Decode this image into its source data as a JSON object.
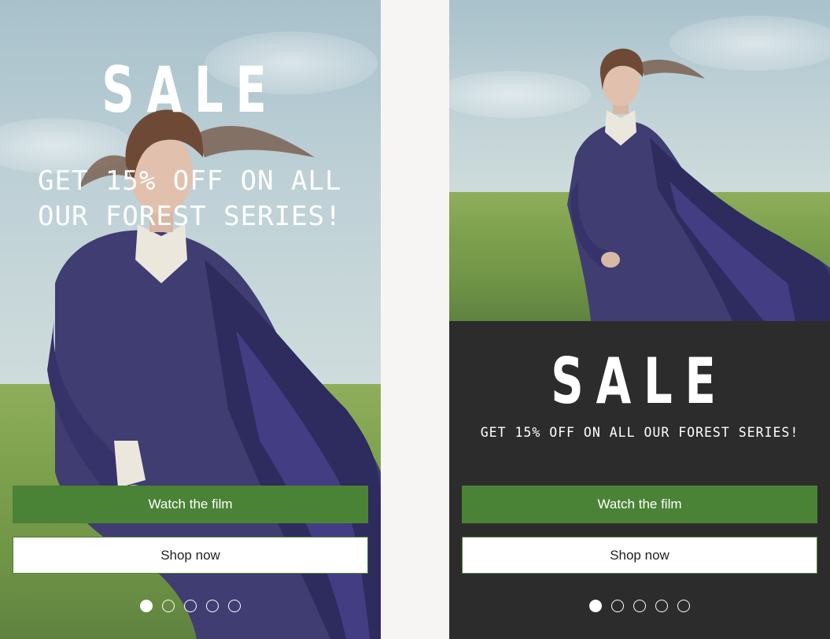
{
  "banners": [
    {
      "id": "overlay-layout",
      "title": "SALE",
      "promo_lines": [
        "GET 15% OFF ON ALL",
        "OUR FOREST SERIES!"
      ],
      "primary_button": "Watch the film",
      "secondary_button": "Shop now",
      "carousel": {
        "total": 5,
        "active": 1
      }
    },
    {
      "id": "stacked-layout",
      "title": "SALE",
      "promo": "GET 15% OFF ON ALL OUR FOREST SERIES!",
      "primary_button": "Watch the film",
      "secondary_button": "Shop now",
      "carousel": {
        "total": 5,
        "active": 1
      }
    }
  ],
  "colors": {
    "accent_green": "#4a8236",
    "dark_panel": "#2d2c2c",
    "page_background": "#f7f5f3",
    "text_light": "#ffffff"
  }
}
